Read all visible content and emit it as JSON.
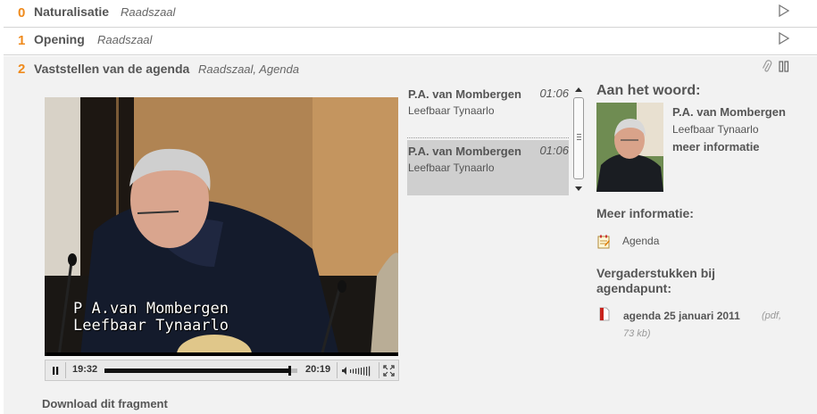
{
  "agenda_items": [
    {
      "number": "0",
      "title": "Naturalisatie",
      "location": "Raadszaal"
    },
    {
      "number": "1",
      "title": "Opening",
      "location": "Raadszaal"
    }
  ],
  "current_item": {
    "number": "2",
    "title": "Vaststellen van de agenda",
    "location": "Raadszaal, Agenda"
  },
  "video": {
    "caption_line1": "P A.van Mombergen",
    "caption_line2": "Leefbaar Tynaarlo",
    "current_time": "19:32",
    "duration": "20:19",
    "progress": 0.96
  },
  "download_label": "Download dit fragment",
  "speakers": [
    {
      "name": "P.A. van Mombergen",
      "party": "Leefbaar Tynaarlo",
      "time": "01:06",
      "selected": false
    },
    {
      "name": "P.A. van Mombergen",
      "party": "Leefbaar Tynaarlo",
      "time": "01:06",
      "selected": true
    }
  ],
  "panel": {
    "aan_het_woord": "Aan het woord:",
    "speaker_name": "P.A. van Mombergen",
    "speaker_party": "Leefbaar Tynaarlo",
    "speaker_more": "meer informatie",
    "meer_informatie": "Meer informatie:",
    "agenda_link": "Agenda",
    "vergaderstukken": "Vergaderstukken bij agendapunt:",
    "document": {
      "title": "agenda 25 januari 2011",
      "type": "(pdf,",
      "size": "73 kb)"
    }
  },
  "colors": {
    "accent": "#ef8a1c",
    "background": "#f2f2f2",
    "text": "#555555"
  },
  "icons": [
    "play-icon",
    "paperclip-icon",
    "pause-icon",
    "volume-icon",
    "fullscreen-icon",
    "agenda-icon",
    "pdf-icon"
  ]
}
